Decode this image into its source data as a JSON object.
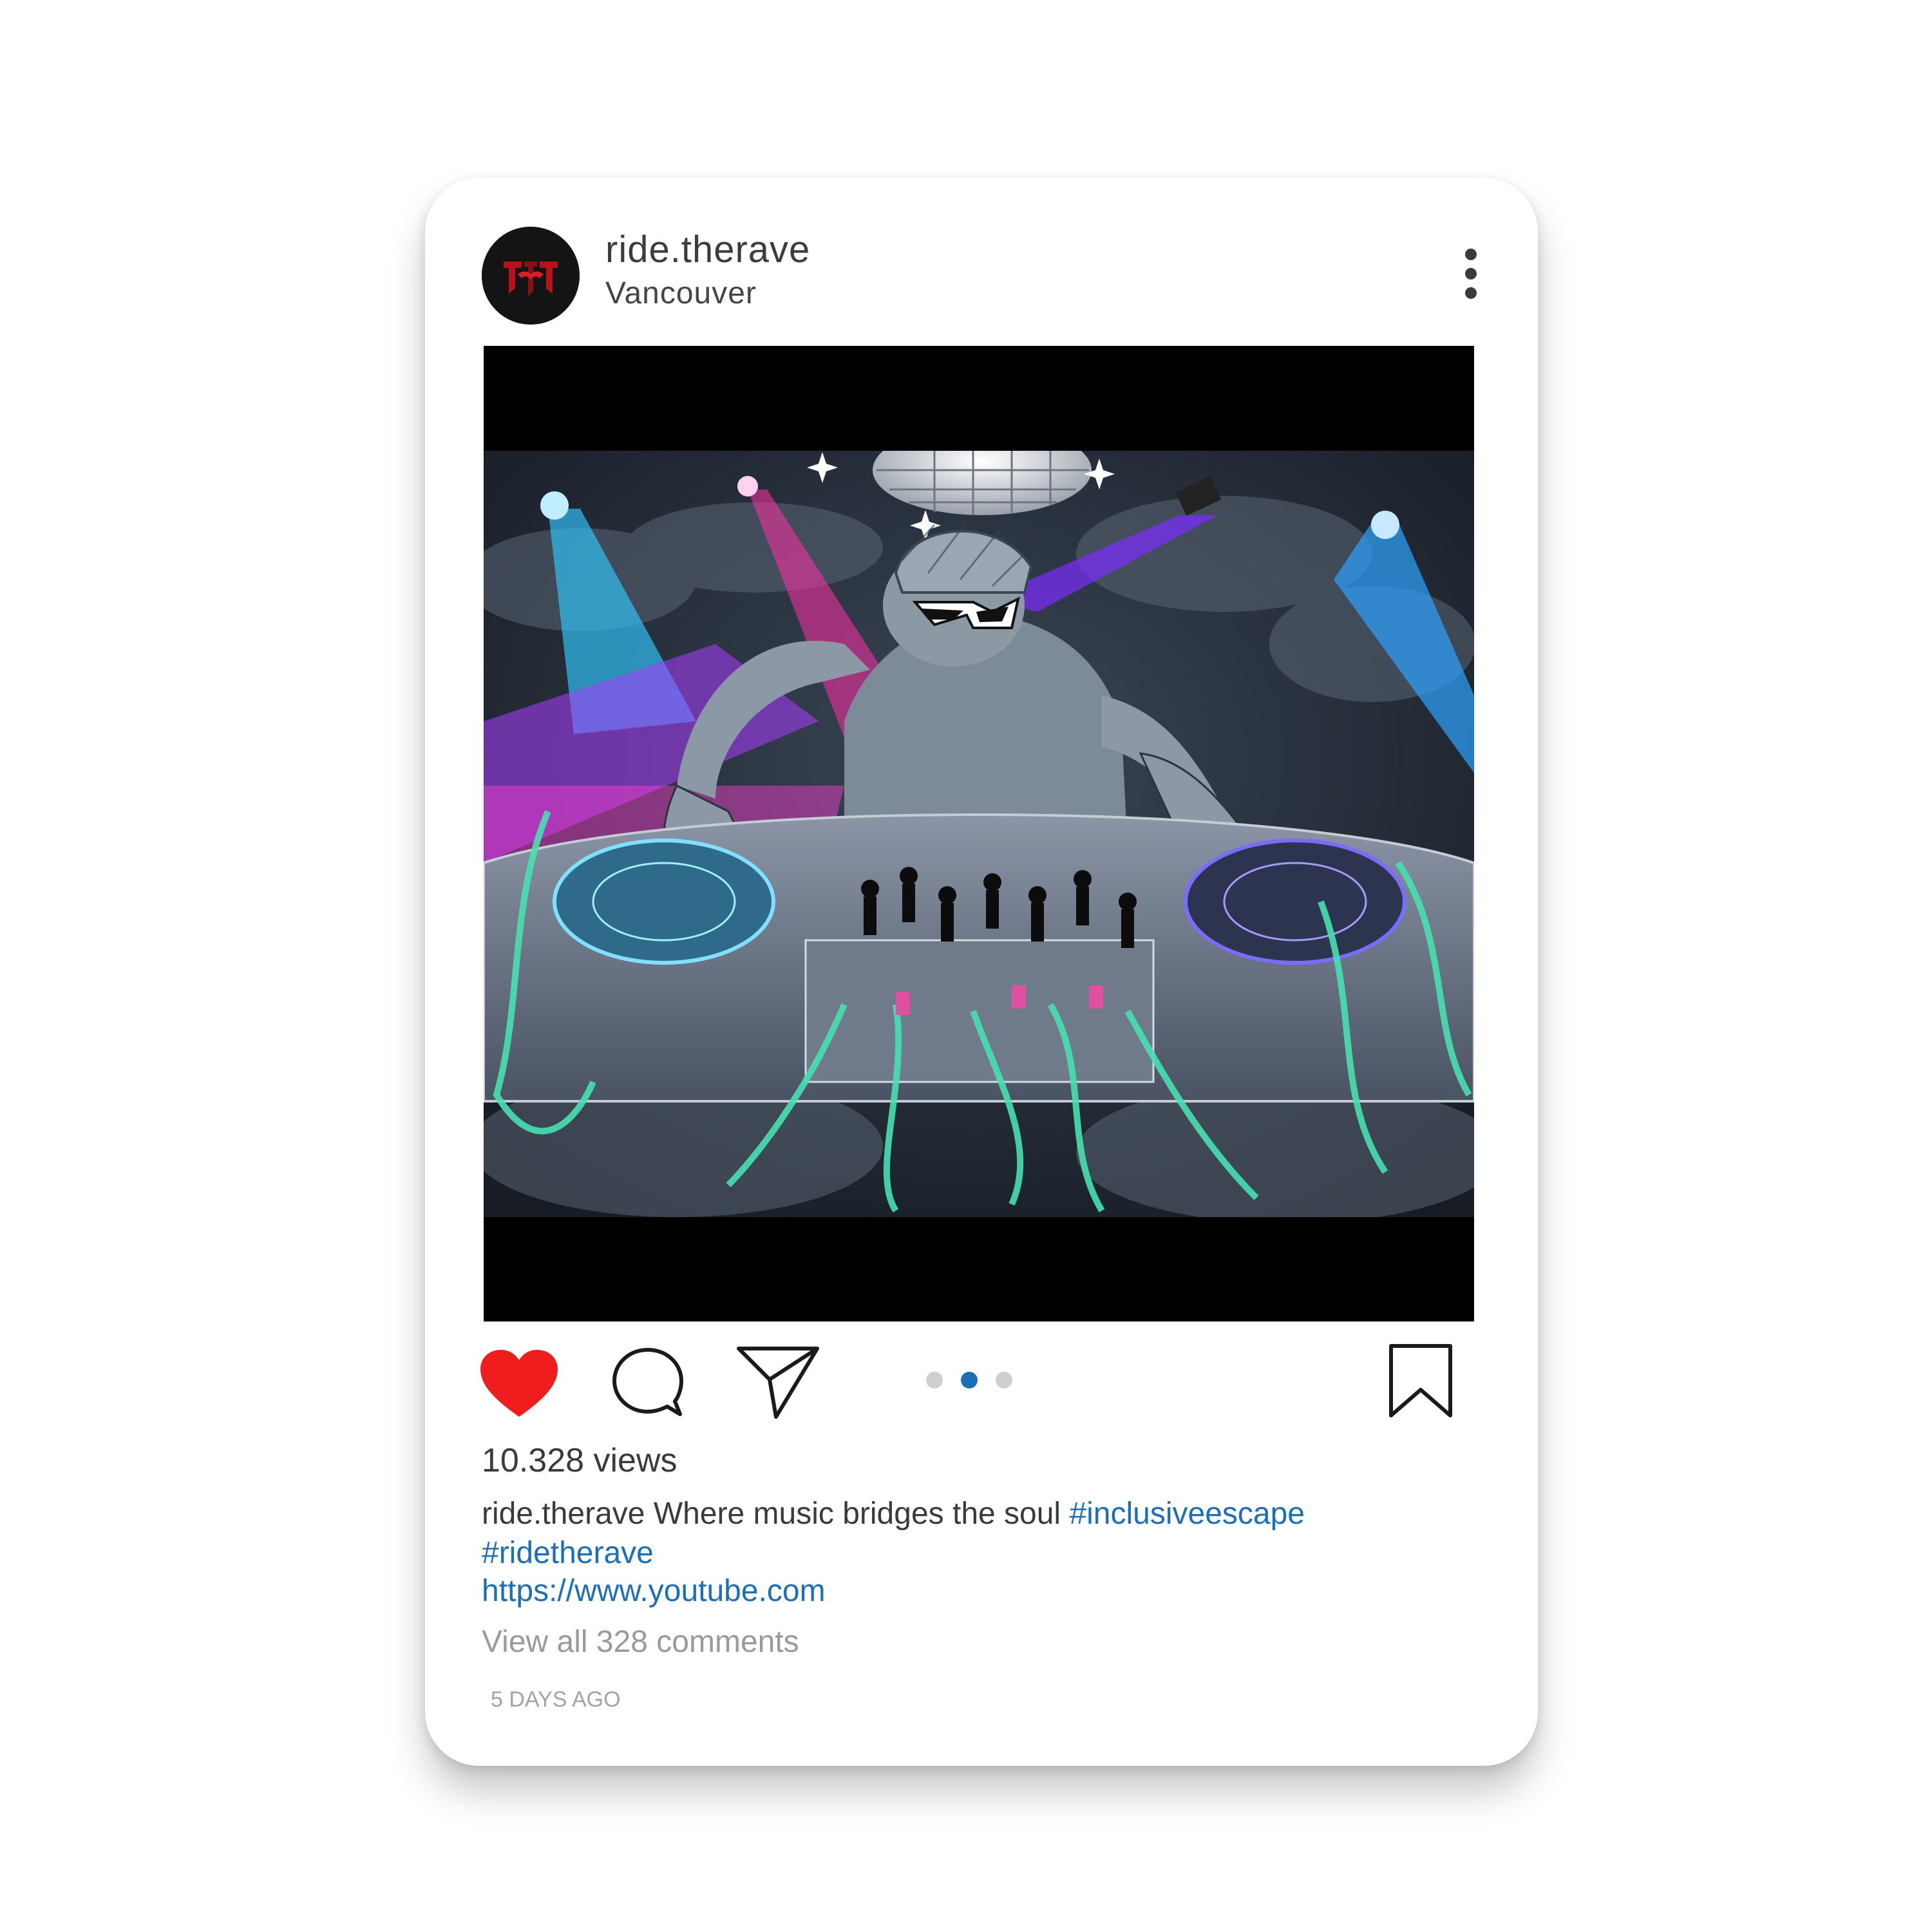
{
  "post": {
    "username": "ride.therave",
    "location": "Vancouver",
    "views": "10.328 views",
    "caption": {
      "user": "ride.therave",
      "text": " Where music bridges the soul ",
      "hashtags": [
        "#inclusiveescape",
        "#ridetherave"
      ]
    },
    "link": "https://www.youtube.com",
    "view_comments": "View all 328 comments",
    "timestamp": "5 DAYS AGO"
  },
  "actions": {
    "like_icon": "heart-icon",
    "comment_icon": "comment-icon",
    "share_icon": "send-icon",
    "save_icon": "bookmark-icon",
    "more_icon": "more-vertical-icon",
    "liked": true
  },
  "carousel": {
    "count": 3,
    "active_index": 1,
    "active_color": "#1b6fb8",
    "inactive_color": "#cfcfcf"
  },
  "colors": {
    "like": "#ef1d1d",
    "link": "#1b6fb8",
    "avatar_logo": "#b5121b"
  }
}
